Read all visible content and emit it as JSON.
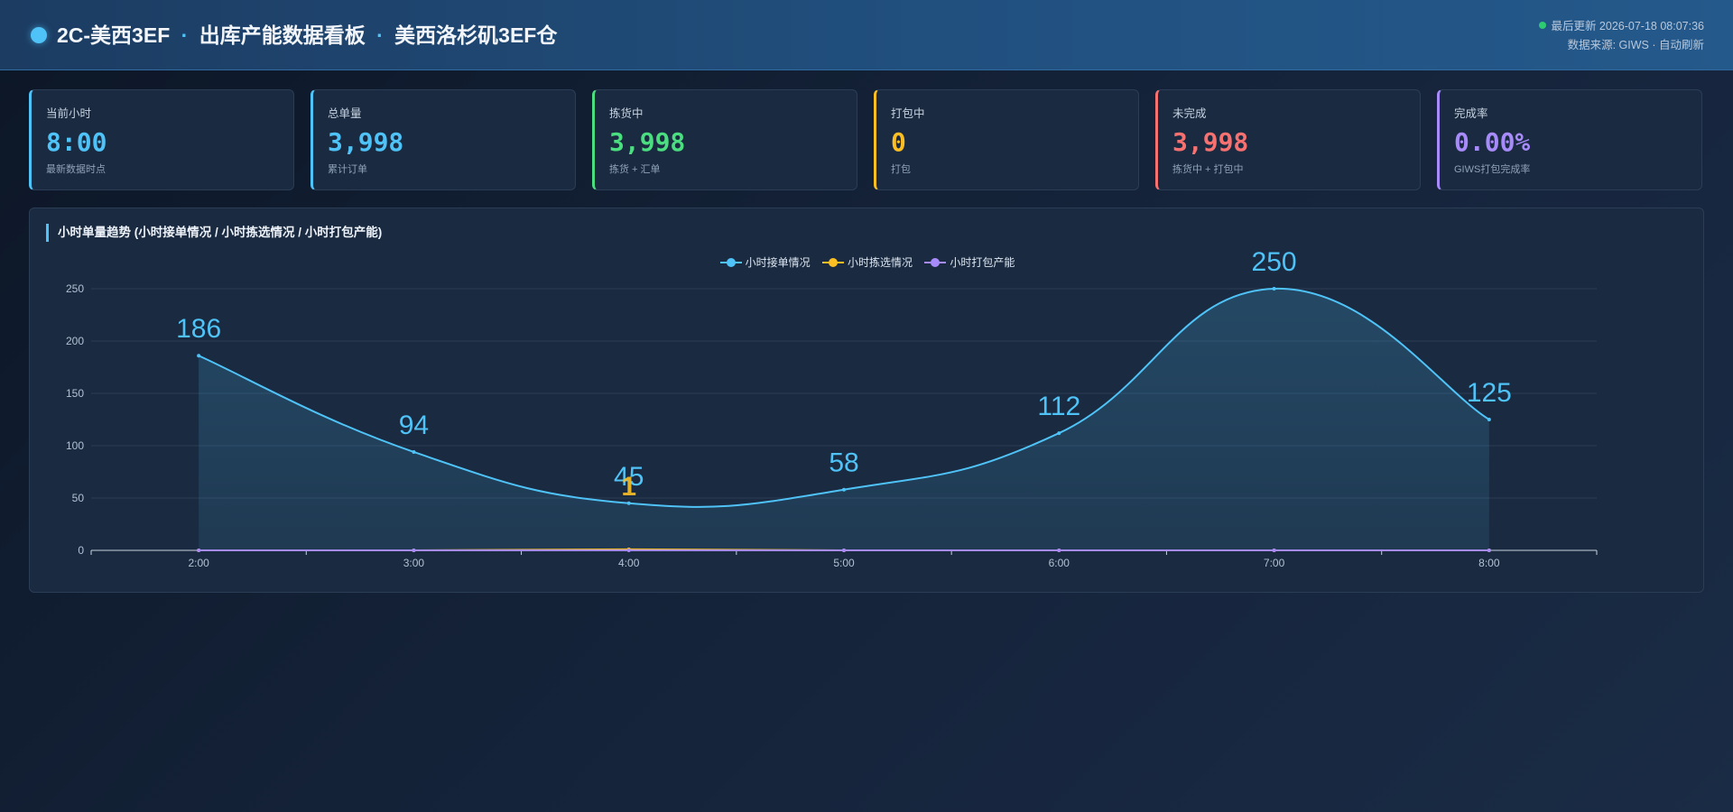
{
  "header": {
    "title_main": "2C-美西3EF",
    "separator": "·",
    "title_mid": "出库产能数据看板",
    "title_site": "美西洛杉矶3EF仓",
    "last_update": "最后更新 2026-07-18 08:07:36",
    "source": "数据来源: GIWS · 自动刷新"
  },
  "kpis": [
    {
      "label": "当前小时",
      "value": "8:00",
      "sub": "最新数据时点",
      "color": "#4fc3f7"
    },
    {
      "label": "总单量",
      "value": "3,998",
      "sub": "累计订单",
      "color": "#4fc3f7"
    },
    {
      "label": "拣货中",
      "value": "3,998",
      "sub": "拣货 + 汇单",
      "color": "#4ade80"
    },
    {
      "label": "打包中",
      "value": "0",
      "sub": "打包",
      "color": "#fbbf24"
    },
    {
      "label": "未完成",
      "value": "3,998",
      "sub": "拣货中 + 打包中",
      "color": "#f87171"
    },
    {
      "label": "完成率",
      "value": "0.00%",
      "sub": "GIWS打包完成率",
      "color": "#a78bfa"
    }
  ],
  "chart_data": {
    "type": "line",
    "title": "小时单量趋势 (小时接单情况 / 小时拣选情况 / 小时打包产能)",
    "categories": [
      "2:00",
      "3:00",
      "4:00",
      "5:00",
      "6:00",
      "7:00",
      "8:00"
    ],
    "ylim": [
      0,
      250
    ],
    "yticks": [
      0,
      50,
      100,
      150,
      200,
      250
    ],
    "grid": true,
    "legend": "top-center",
    "series": [
      {
        "name": "小时接单情况",
        "color": "#4fc3f7",
        "values": [
          186,
          94,
          45,
          58,
          112,
          250,
          125
        ],
        "area": true,
        "smooth": true,
        "labels": true
      },
      {
        "name": "小时拣选情况",
        "color": "#fbbf24",
        "values": [
          0,
          0,
          1,
          0,
          0,
          0,
          0
        ],
        "labels": false,
        "label_at": [
          {
            "index": 2,
            "text": "1"
          }
        ]
      },
      {
        "name": "小时打包产能",
        "color": "#a78bfa",
        "values": [
          0,
          0,
          0,
          0,
          0,
          0,
          0
        ],
        "labels": false
      }
    ]
  }
}
